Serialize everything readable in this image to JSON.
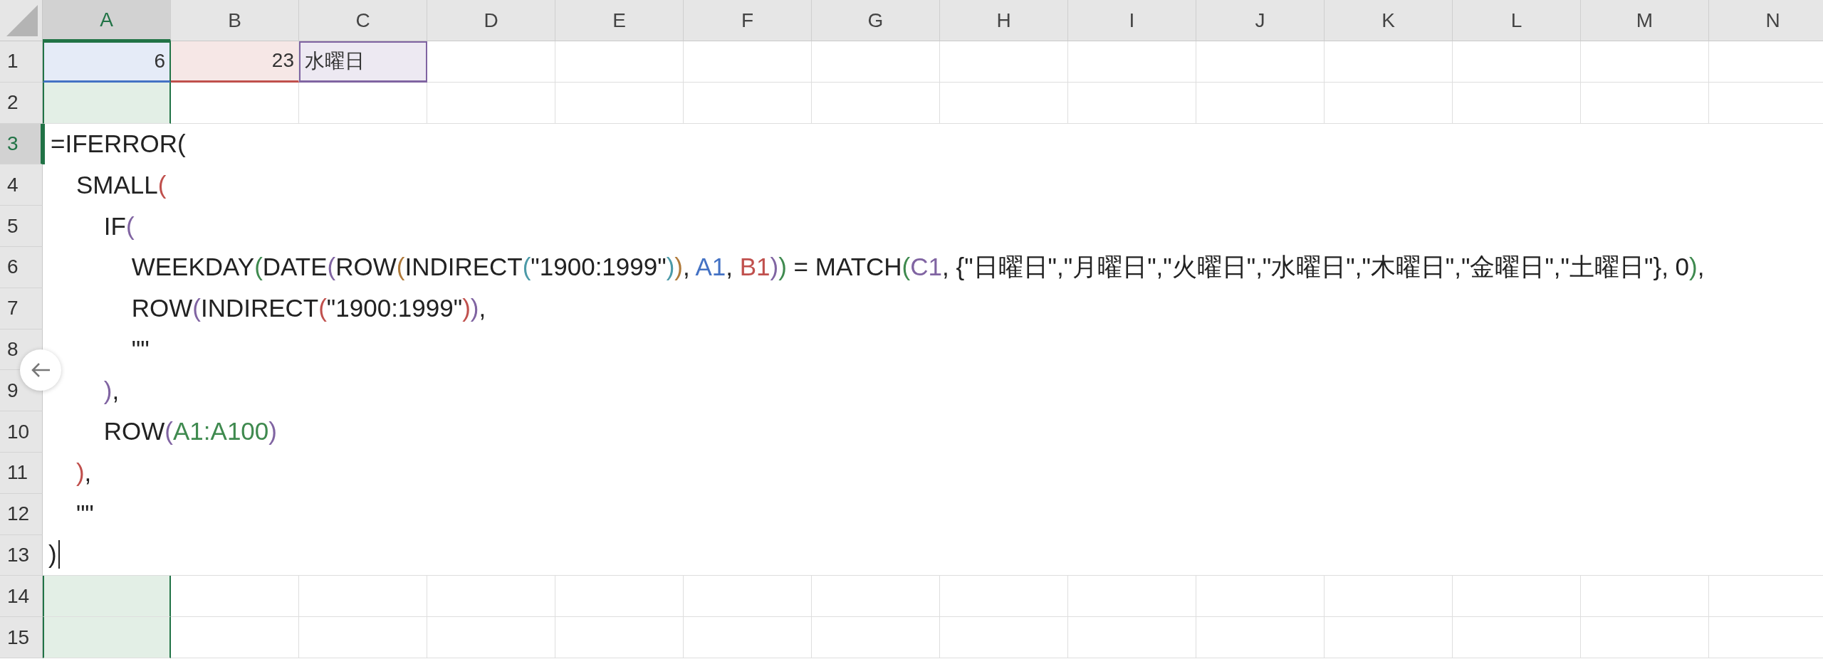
{
  "columns": [
    {
      "label": "A",
      "selected": true
    },
    {
      "label": "B",
      "selected": false
    },
    {
      "label": "C",
      "selected": false
    },
    {
      "label": "D",
      "selected": false
    },
    {
      "label": "E",
      "selected": false
    },
    {
      "label": "F",
      "selected": false
    },
    {
      "label": "G",
      "selected": false
    },
    {
      "label": "H",
      "selected": false
    },
    {
      "label": "I",
      "selected": false
    },
    {
      "label": "J",
      "selected": false
    },
    {
      "label": "K",
      "selected": false
    },
    {
      "label": "L",
      "selected": false
    },
    {
      "label": "M",
      "selected": false
    },
    {
      "label": "N",
      "selected": false
    }
  ],
  "rows": [
    {
      "label": "1",
      "selected": false
    },
    {
      "label": "2",
      "selected": false
    },
    {
      "label": "3",
      "selected": true
    },
    {
      "label": "4",
      "selected": false
    },
    {
      "label": "5",
      "selected": false
    },
    {
      "label": "6",
      "selected": false
    },
    {
      "label": "7",
      "selected": false
    },
    {
      "label": "8",
      "selected": false
    },
    {
      "label": "9",
      "selected": false
    },
    {
      "label": "10",
      "selected": false
    },
    {
      "label": "11",
      "selected": false
    },
    {
      "label": "12",
      "selected": false
    },
    {
      "label": "13",
      "selected": false
    },
    {
      "label": "14",
      "selected": false
    },
    {
      "label": "15",
      "selected": false
    }
  ],
  "row_1_cells": [
    {
      "value": "6",
      "kind": "number",
      "color": "#4472c4"
    },
    {
      "value": "23",
      "kind": "number",
      "color": "#c0504d"
    },
    {
      "value": "水曜日",
      "kind": "text",
      "color": "#8064a2"
    }
  ],
  "editor": {
    "lines": [
      [
        {
          "text": "=IFERROR("
        }
      ],
      [
        {
          "text": "    SMALL"
        },
        {
          "text": "(",
          "color": "#c0504d"
        }
      ],
      [
        {
          "text": "        IF"
        },
        {
          "text": "(",
          "color": "#8064a2"
        }
      ],
      [
        {
          "text": "            WEEKDAY"
        },
        {
          "text": "(",
          "color": "#3f8a4f"
        },
        {
          "text": "DATE"
        },
        {
          "text": "(",
          "color": "#8064a2"
        },
        {
          "text": "ROW"
        },
        {
          "text": "(",
          "color": "#b07a3a"
        },
        {
          "text": "INDIRECT"
        },
        {
          "text": "(",
          "color": "#4c9aa8"
        },
        {
          "text": "\"1900:1999\""
        },
        {
          "text": ")",
          "color": "#4c9aa8"
        },
        {
          "text": ")",
          "color": "#b07a3a"
        },
        {
          "text": ", "
        },
        {
          "text": "A1",
          "color": "#4472c4"
        },
        {
          "text": ", "
        },
        {
          "text": "B1",
          "color": "#c0504d"
        },
        {
          "text": ")",
          "color": "#8064a2"
        },
        {
          "text": ")",
          "color": "#3f8a4f"
        },
        {
          "text": " = MATCH"
        },
        {
          "text": "(",
          "color": "#3f8a4f"
        },
        {
          "text": "C1",
          "color": "#8064a2"
        },
        {
          "text": ", {\"日曜日\",\"月曜日\",\"火曜日\",\"水曜日\",\"木曜日\",\"金曜日\",\"土曜日\"}, 0"
        },
        {
          "text": ")",
          "color": "#3f8a4f"
        },
        {
          "text": ","
        }
      ],
      [
        {
          "text": "            ROW"
        },
        {
          "text": "(",
          "color": "#8064a2"
        },
        {
          "text": "INDIRECT"
        },
        {
          "text": "(",
          "color": "#c0504d"
        },
        {
          "text": "\"1900:1999\""
        },
        {
          "text": ")",
          "color": "#c0504d"
        },
        {
          "text": ")",
          "color": "#8064a2"
        },
        {
          "text": ","
        }
      ],
      [
        {
          "text": "            \"\""
        }
      ],
      [
        {
          "text": "        )",
          "color": "#8064a2"
        },
        {
          "text": ","
        }
      ],
      [
        {
          "text": "        ROW"
        },
        {
          "text": "(",
          "color": "#8064a2"
        },
        {
          "text": "A1:A100",
          "color": "#3f8a4f"
        },
        {
          "text": ")",
          "color": "#8064a2"
        }
      ],
      [
        {
          "text": "    )",
          "color": "#c0504d"
        },
        {
          "text": ","
        }
      ],
      [
        {
          "text": "    \"\""
        }
      ],
      [
        {
          "text": ")"
        }
      ]
    ]
  }
}
